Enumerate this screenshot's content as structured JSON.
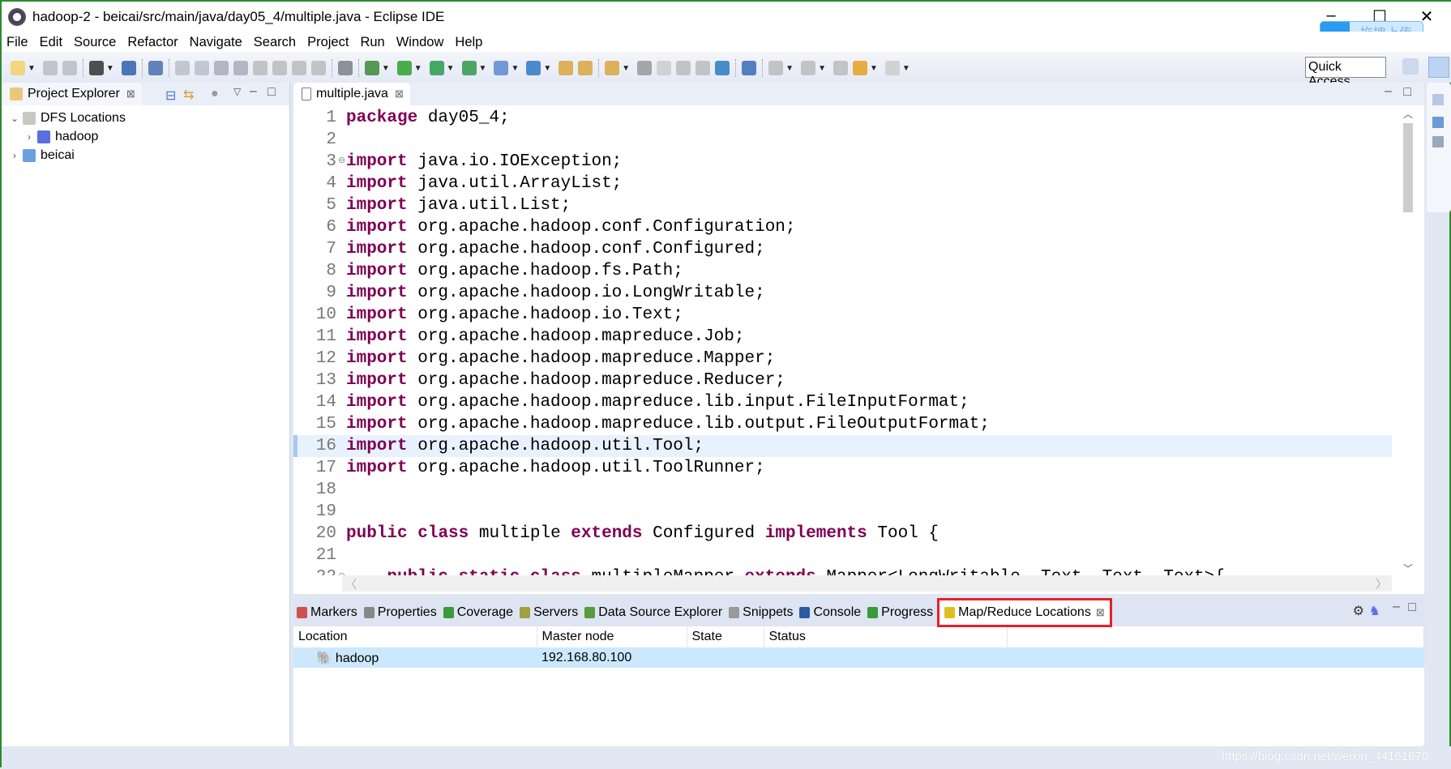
{
  "window": {
    "title": "hadoop-2 - beicai/src/main/java/day05_4/multiple.java - Eclipse IDE",
    "minimize": "–",
    "maximize": "☐",
    "close": "✕"
  },
  "overlay": {
    "upload_label": "拖拽上传",
    "icon": "cloud-icon"
  },
  "menu": [
    "File",
    "Edit",
    "Source",
    "Refactor",
    "Navigate",
    "Search",
    "Project",
    "Run",
    "Window",
    "Help"
  ],
  "toolbar": {
    "quick_access": "Quick Access",
    "icons": [
      "new",
      "save",
      "save-all",
      "profile",
      "terminal",
      "skip-breakpoints",
      "resume",
      "suspend",
      "terminate",
      "disconnect",
      "step-into",
      "step-over",
      "step-return",
      "drop-frame",
      "use-step-filters",
      "debug",
      "run",
      "coverage",
      "external-tools",
      "new-server",
      "new-spring",
      "open-type",
      "open-task",
      "search",
      "toggle-mark",
      "annotation",
      "block-select",
      "whitespace",
      "globe",
      "launch",
      "next-annotation",
      "prev-annotation",
      "last-edit",
      "back",
      "forward"
    ]
  },
  "colors": {
    "keyword": "#7f0055",
    "highlight": "#e8f2fe",
    "selected_row": "#cce8ff",
    "callout": "#e8202a"
  },
  "project_explorer": {
    "title": "Project Explorer",
    "tree": [
      {
        "label": "DFS Locations",
        "expanded": true,
        "level": 0
      },
      {
        "label": "hadoop",
        "expanded": false,
        "level": 1
      },
      {
        "label": "beicai",
        "expanded": false,
        "level": 0
      }
    ]
  },
  "editor": {
    "tab": "multiple.java",
    "current_line": 16,
    "lines": [
      [
        {
          "k": 1,
          "v": "package"
        },
        {
          "v": " day05_4;"
        }
      ],
      [],
      [
        {
          "k": 1,
          "v": "import"
        },
        {
          "v": " java.io.IOException;"
        }
      ],
      [
        {
          "k": 1,
          "v": "import"
        },
        {
          "v": " java.util.ArrayList;"
        }
      ],
      [
        {
          "k": 1,
          "v": "import"
        },
        {
          "v": " java.util.List;"
        }
      ],
      [
        {
          "k": 1,
          "v": "import"
        },
        {
          "v": " org.apache.hadoop.conf.Configuration;"
        }
      ],
      [
        {
          "k": 1,
          "v": "import"
        },
        {
          "v": " org.apache.hadoop.conf.Configured;"
        }
      ],
      [
        {
          "k": 1,
          "v": "import"
        },
        {
          "v": " org.apache.hadoop.fs.Path;"
        }
      ],
      [
        {
          "k": 1,
          "v": "import"
        },
        {
          "v": " org.apache.hadoop.io.LongWritable;"
        }
      ],
      [
        {
          "k": 1,
          "v": "import"
        },
        {
          "v": " org.apache.hadoop.io.Text;"
        }
      ],
      [
        {
          "k": 1,
          "v": "import"
        },
        {
          "v": " org.apache.hadoop.mapreduce.Job;"
        }
      ],
      [
        {
          "k": 1,
          "v": "import"
        },
        {
          "v": " org.apache.hadoop.mapreduce.Mapper;"
        }
      ],
      [
        {
          "k": 1,
          "v": "import"
        },
        {
          "v": " org.apache.hadoop.mapreduce.Reducer;"
        }
      ],
      [
        {
          "k": 1,
          "v": "import"
        },
        {
          "v": " org.apache.hadoop.mapreduce.lib.input.FileInputFormat;"
        }
      ],
      [
        {
          "k": 1,
          "v": "import"
        },
        {
          "v": " org.apache.hadoop.mapreduce.lib.output.FileOutputFormat;"
        }
      ],
      [
        {
          "k": 1,
          "v": "import"
        },
        {
          "v": " org.apache.hadoop.util.Tool;"
        }
      ],
      [
        {
          "k": 1,
          "v": "import"
        },
        {
          "v": " org.apache.hadoop.util.ToolRunner;"
        }
      ],
      [],
      [],
      [
        {
          "k": 1,
          "v": "public"
        },
        {
          "v": " "
        },
        {
          "k": 1,
          "v": "class"
        },
        {
          "v": " multiple "
        },
        {
          "k": 1,
          "v": "extends"
        },
        {
          "v": " Configured "
        },
        {
          "k": 1,
          "v": "implements"
        },
        {
          "v": " Tool {"
        }
      ],
      [],
      [
        {
          "v": "    "
        },
        {
          "k": 1,
          "v": "public"
        },
        {
          "v": " "
        },
        {
          "k": 1,
          "v": "static"
        },
        {
          "v": " "
        },
        {
          "k": 1,
          "v": "class"
        },
        {
          "v": " multipleMapper "
        },
        {
          "k": 1,
          "v": "extends"
        },
        {
          "v": " Mapper<LongWritable, Text, Text, Text>{"
        }
      ]
    ],
    "folds": [
      3,
      22
    ]
  },
  "bottom_panel": {
    "tabs": [
      "Markers",
      "Properties",
      "Coverage",
      "Servers",
      "Data Source Explorer",
      "Snippets",
      "Console",
      "Progress",
      "Map/Reduce Locations"
    ],
    "active_tab": "Map/Reduce Locations",
    "columns": [
      "Location",
      "Master node",
      "State",
      "Status"
    ],
    "rows": [
      [
        "hadoop",
        "192.168.80.100",
        "",
        ""
      ]
    ]
  },
  "watermark": "https://blog.csdn.net/weixin_44161670"
}
